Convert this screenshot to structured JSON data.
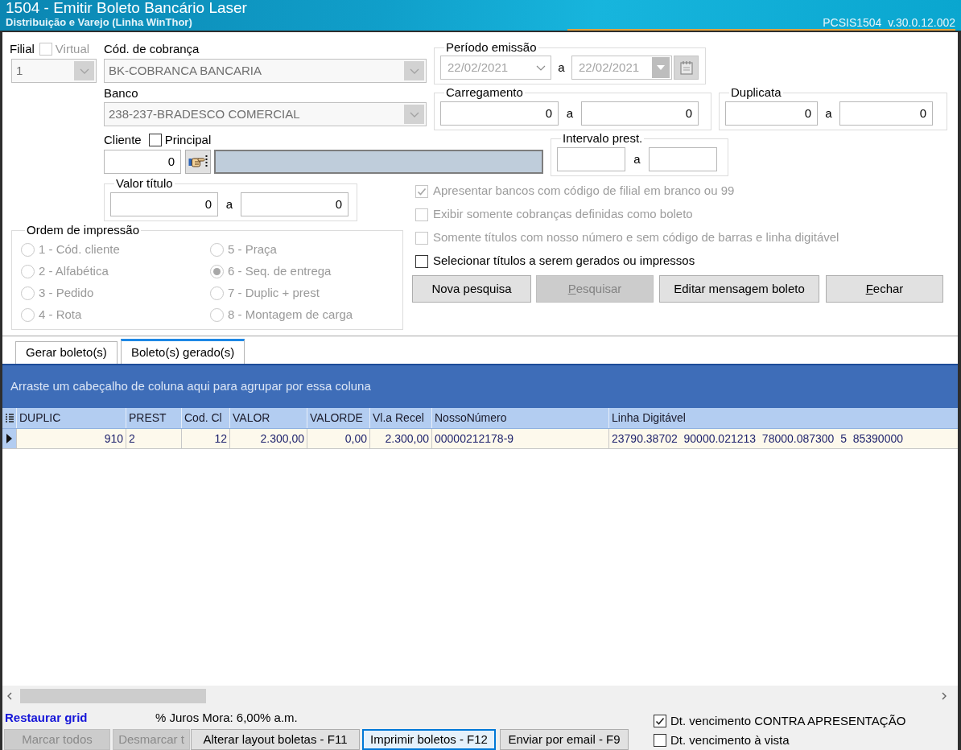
{
  "window": {
    "title": "1504 - Emitir Boleto Bancário Laser",
    "subtitle": "Distribuição e Varejo (Linha WinThor)",
    "version": "PCSIS1504  v.30.0.12.002"
  },
  "filters": {
    "filial": {
      "label": "Filial",
      "value": "1",
      "disabled": true
    },
    "virtual": {
      "label": "Virtual",
      "checked": false,
      "disabled": true
    },
    "cobranca": {
      "label": "Cód. de cobrança",
      "value": "BK-COBRANCA BANCARIA",
      "disabled": true
    },
    "periodo": {
      "label": "Período emissão",
      "from": "22/02/2021",
      "separator": "a",
      "to": "22/02/2021",
      "disabled": true
    },
    "banco": {
      "label": "Banco",
      "value": "238-237-BRADESCO COMERCIAL",
      "disabled": true
    },
    "carregamento": {
      "label": "Carregamento",
      "from": "0",
      "separator": "a",
      "to": "0"
    },
    "duplicata": {
      "label": "Duplicata",
      "from": "0",
      "separator": "a",
      "to": "0"
    },
    "cliente": {
      "label": "Cliente",
      "value": "0"
    },
    "principal": {
      "label": "Principal",
      "checked": false,
      "disabled": false
    },
    "intervalo_prest": {
      "label": "Intervalo prest.",
      "separator": "a"
    },
    "valor_titulo": {
      "label": "Valor título",
      "from": "0",
      "separator": "a",
      "to": "0"
    }
  },
  "ordem_impressao": {
    "label": "Ordem de impressão",
    "disabled": true,
    "options": [
      {
        "label": "1 - Cód. cliente",
        "selected": false
      },
      {
        "label": "2 - Alfabética",
        "selected": false
      },
      {
        "label": "3 - Pedido",
        "selected": false
      },
      {
        "label": "4 - Rota",
        "selected": false
      },
      {
        "label": "5 - Praça",
        "selected": false
      },
      {
        "label": "6 - Seq. de entrega",
        "selected": true
      },
      {
        "label": "7 - Duplic + prest",
        "selected": false
      },
      {
        "label": "8 - Montagem de carga",
        "selected": false
      }
    ]
  },
  "options": [
    {
      "label": "Apresentar bancos com código de filial em branco ou 99",
      "checked": true,
      "disabled": true
    },
    {
      "label": "Exibir somente cobranças definidas como boleto",
      "checked": false,
      "disabled": true
    },
    {
      "label": "Somente títulos com nosso número e sem código de barras e linha digitável",
      "checked": false,
      "disabled": true
    },
    {
      "label": "Selecionar títulos a serem gerados ou impressos",
      "checked": false,
      "disabled": false
    }
  ],
  "actions": [
    {
      "label": "Nova pesquisa",
      "disabled": false
    },
    {
      "label": "Pesquisar",
      "disabled": true,
      "mnemonic": true
    },
    {
      "label": "Editar mensagem boleto",
      "disabled": false
    },
    {
      "label": "Fechar",
      "disabled": false,
      "mnemonic": true
    }
  ],
  "tabs": [
    {
      "label": "Gerar boleto(s)",
      "selected": false
    },
    {
      "label": "Boleto(s) gerado(s)",
      "selected": true
    }
  ],
  "grid": {
    "group_panel": "Arraste um cabeçalho de coluna aqui para agrupar por essa coluna",
    "columns": [
      "DUPLIC",
      "PREST",
      "Cod. Cl",
      "VALOR",
      "VALORDE",
      "Vl.a Recel",
      "NossoNúmero",
      "Linha Digitável"
    ],
    "rows": [
      {
        "selected": true,
        "cells": [
          "910",
          "2",
          "12",
          "2.300,00",
          "0,00",
          "2.300,00",
          "00000212178-9",
          "23790.38702  90000.021213  78000.087300  5  85390000"
        ]
      }
    ]
  },
  "footer": {
    "restore_link": "Restaurar grid",
    "interest": "% Juros Mora: 6,00% a.m.",
    "buttons": [
      {
        "label": "Marcar todos",
        "disabled": true
      },
      {
        "label": "Desmarcar t",
        "disabled": true
      },
      {
        "label": "Alterar layout boletas - F11",
        "disabled": false
      },
      {
        "label": "Imprimir boletos - F12",
        "disabled": false,
        "focused": true
      },
      {
        "label": "Enviar por email - F9",
        "disabled": false
      }
    ],
    "checks": [
      {
        "label": "Dt. vencimento CONTRA APRESENTAÇÃO",
        "checked": true
      },
      {
        "label": "Dt. vencimento à vista",
        "checked": false
      }
    ]
  }
}
